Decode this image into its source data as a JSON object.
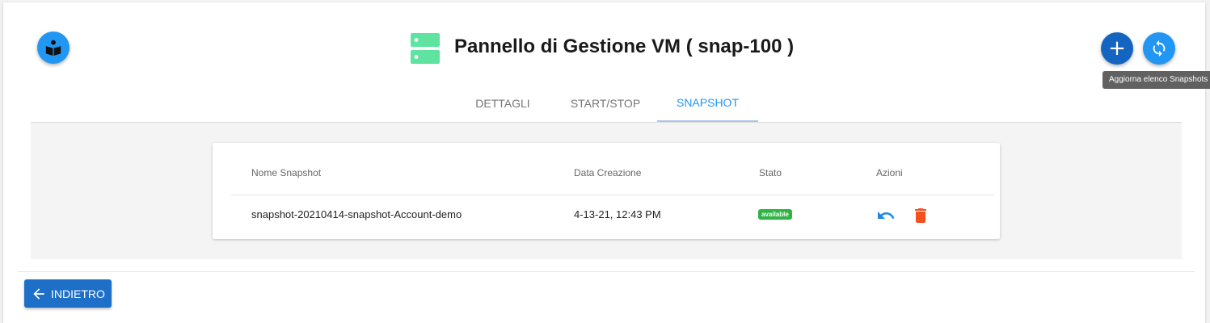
{
  "header": {
    "title": "Pannello di Gestione VM ( snap-100 )",
    "add_button_label": "+",
    "refresh_tooltip": "Aggiorna elenco Snapshots"
  },
  "tabs": [
    {
      "label": "DETTAGLI",
      "active": false
    },
    {
      "label": "START/STOP",
      "active": false
    },
    {
      "label": "SNAPSHOT",
      "active": true
    }
  ],
  "table": {
    "headers": [
      "Nome Snapshot",
      "Data Creazione",
      "Stato",
      "Azioni"
    ],
    "rows": [
      {
        "name": "snapshot-20210414-snapshot-Account-demo",
        "created": "4-13-21, 12:43 PM",
        "status": "available",
        "actions": [
          "restore-icon",
          "delete-icon"
        ]
      }
    ]
  },
  "footer": {
    "back_label": "INDIETRO"
  },
  "colors": {
    "primary": "#2196f3",
    "primary_dark": "#1565c0",
    "status_available": "#2fb344",
    "delete": "#f4511e",
    "server_icon": "#5ee3a1"
  },
  "icons": {
    "left_fab": "book-reader-icon",
    "add_fab": "plus-icon",
    "refresh_fab": "refresh-icon",
    "title_icon": "server-icon",
    "back": "arrow-left-icon"
  }
}
